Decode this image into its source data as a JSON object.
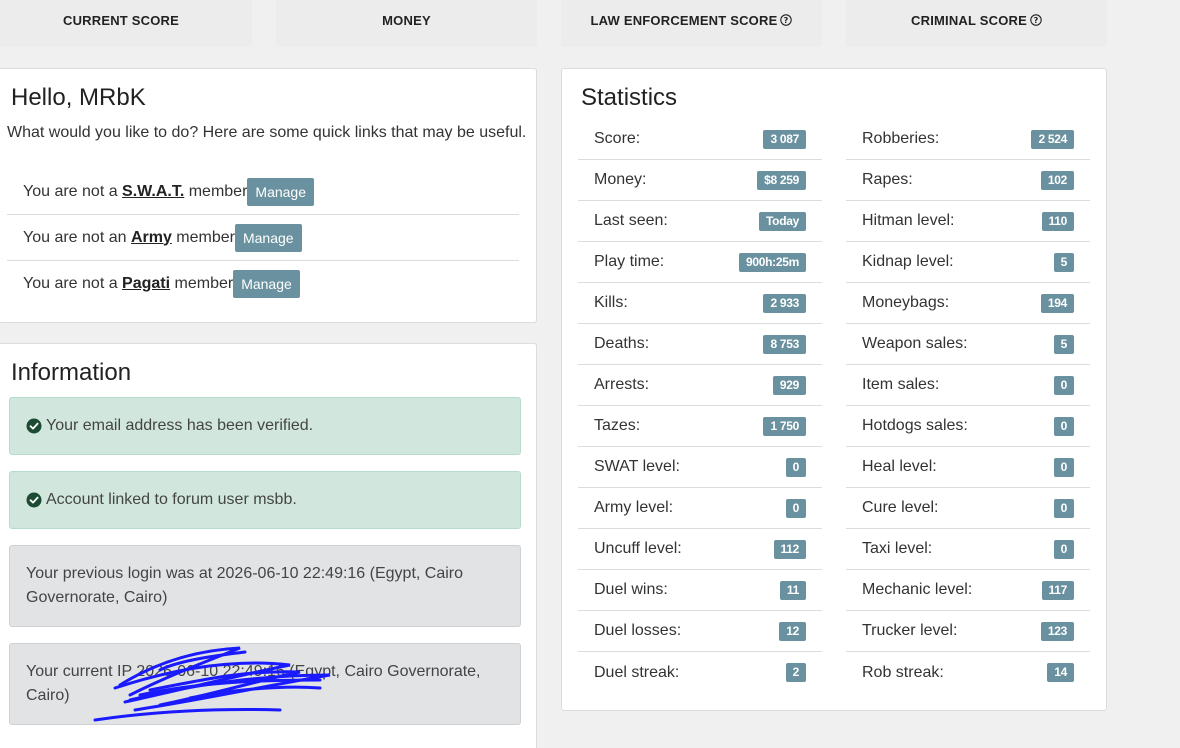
{
  "top_tiles": [
    {
      "label": "CURRENT SCORE"
    },
    {
      "label": "MONEY"
    },
    {
      "label": "LAW ENFORCEMENT SCORE",
      "help": true
    },
    {
      "label": "CRIMINAL SCORE",
      "help": true
    }
  ],
  "hello": {
    "title": "Hello, MRbK",
    "intro": "What would you like to do? Here are some quick links that may be useful.",
    "members": [
      {
        "prefix": "You are not a ",
        "group": "S.W.A.T.",
        "suffix": " member",
        "button": "Manage"
      },
      {
        "prefix": "You are not an ",
        "group": "Army",
        "suffix": " member",
        "button": "Manage"
      },
      {
        "prefix": "You are not a ",
        "group": "Pagati",
        "suffix": " member",
        "button": "Manage"
      }
    ]
  },
  "information": {
    "title": "Information",
    "email_verified": "Your email address has been verified.",
    "forum_linked": "Account linked to forum user msbb.",
    "previous_login": "Your previous login was at 2026-06-10 22:49:16 (Egypt, Cairo Governorate, Cairo)",
    "current_login": "Your current IP 2026-06-10 22:49:16 (Egypt, Cairo Governorate, Cairo)"
  },
  "statistics": {
    "title": "Statistics",
    "left": [
      {
        "label": "Score:",
        "value": "3 087"
      },
      {
        "label": "Money:",
        "value": "$8 259"
      },
      {
        "label": "Last seen:",
        "value": "Today"
      },
      {
        "label": "Play time:",
        "value": "900h:25m"
      },
      {
        "label": "Kills:",
        "value": "2 933"
      },
      {
        "label": "Deaths:",
        "value": "8 753"
      },
      {
        "label": "Arrests:",
        "value": "929"
      },
      {
        "label": "Tazes:",
        "value": "1 750"
      },
      {
        "label": "SWAT level:",
        "value": "0"
      },
      {
        "label": "Army level:",
        "value": "0"
      },
      {
        "label": "Uncuff level:",
        "value": "112"
      },
      {
        "label": "Duel wins:",
        "value": "11"
      },
      {
        "label": "Duel losses:",
        "value": "12"
      },
      {
        "label": "Duel streak:",
        "value": "2"
      }
    ],
    "right": [
      {
        "label": "Robberies:",
        "value": "2 524"
      },
      {
        "label": "Rapes:",
        "value": "102"
      },
      {
        "label": "Hitman level:",
        "value": "110"
      },
      {
        "label": "Kidnap level:",
        "value": "5"
      },
      {
        "label": "Moneybags:",
        "value": "194"
      },
      {
        "label": "Weapon sales:",
        "value": "5"
      },
      {
        "label": "Item sales:",
        "value": "0"
      },
      {
        "label": "Hotdogs sales:",
        "value": "0"
      },
      {
        "label": "Heal level:",
        "value": "0"
      },
      {
        "label": "Cure level:",
        "value": "0"
      },
      {
        "label": "Taxi level:",
        "value": "0"
      },
      {
        "label": "Mechanic level:",
        "value": "117"
      },
      {
        "label": "Trucker level:",
        "value": "123"
      },
      {
        "label": "Rob streak:",
        "value": "14"
      }
    ]
  },
  "colors": {
    "badge": "#6a919f",
    "success_bg": "#d1e7dd",
    "grey_bg": "#e2e3e5",
    "scribble": "#1a1aff"
  }
}
